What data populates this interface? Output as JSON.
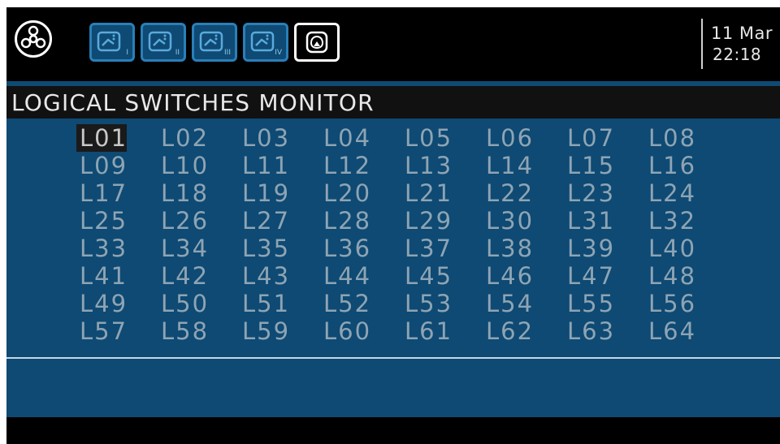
{
  "header": {
    "tabs": [
      {
        "name": "page-1",
        "number": "I"
      },
      {
        "name": "page-2",
        "number": "II"
      },
      {
        "name": "page-3",
        "number": "III"
      },
      {
        "name": "page-4",
        "number": "IV"
      }
    ],
    "date": "11 Mar",
    "time": "22:18"
  },
  "page": {
    "title": "LOGICAL SWITCHES MONITOR",
    "selected": "L01",
    "switches": [
      "L01",
      "L02",
      "L03",
      "L04",
      "L05",
      "L06",
      "L07",
      "L08",
      "L09",
      "L10",
      "L11",
      "L12",
      "L13",
      "L14",
      "L15",
      "L16",
      "L17",
      "L18",
      "L19",
      "L20",
      "L21",
      "L22",
      "L23",
      "L24",
      "L25",
      "L26",
      "L27",
      "L28",
      "L29",
      "L30",
      "L31",
      "L32",
      "L33",
      "L34",
      "L35",
      "L36",
      "L37",
      "L38",
      "L39",
      "L40",
      "L41",
      "L42",
      "L43",
      "L44",
      "L45",
      "L46",
      "L47",
      "L48",
      "L49",
      "L50",
      "L51",
      "L52",
      "L53",
      "L54",
      "L55",
      "L56",
      "L57",
      "L58",
      "L59",
      "L60",
      "L61",
      "L62",
      "L63",
      "L64"
    ]
  },
  "colors": {
    "panel_blue": "#0e4a73",
    "switch_text": "#8ea4b4",
    "selection_bg": "#1a1a1a"
  }
}
